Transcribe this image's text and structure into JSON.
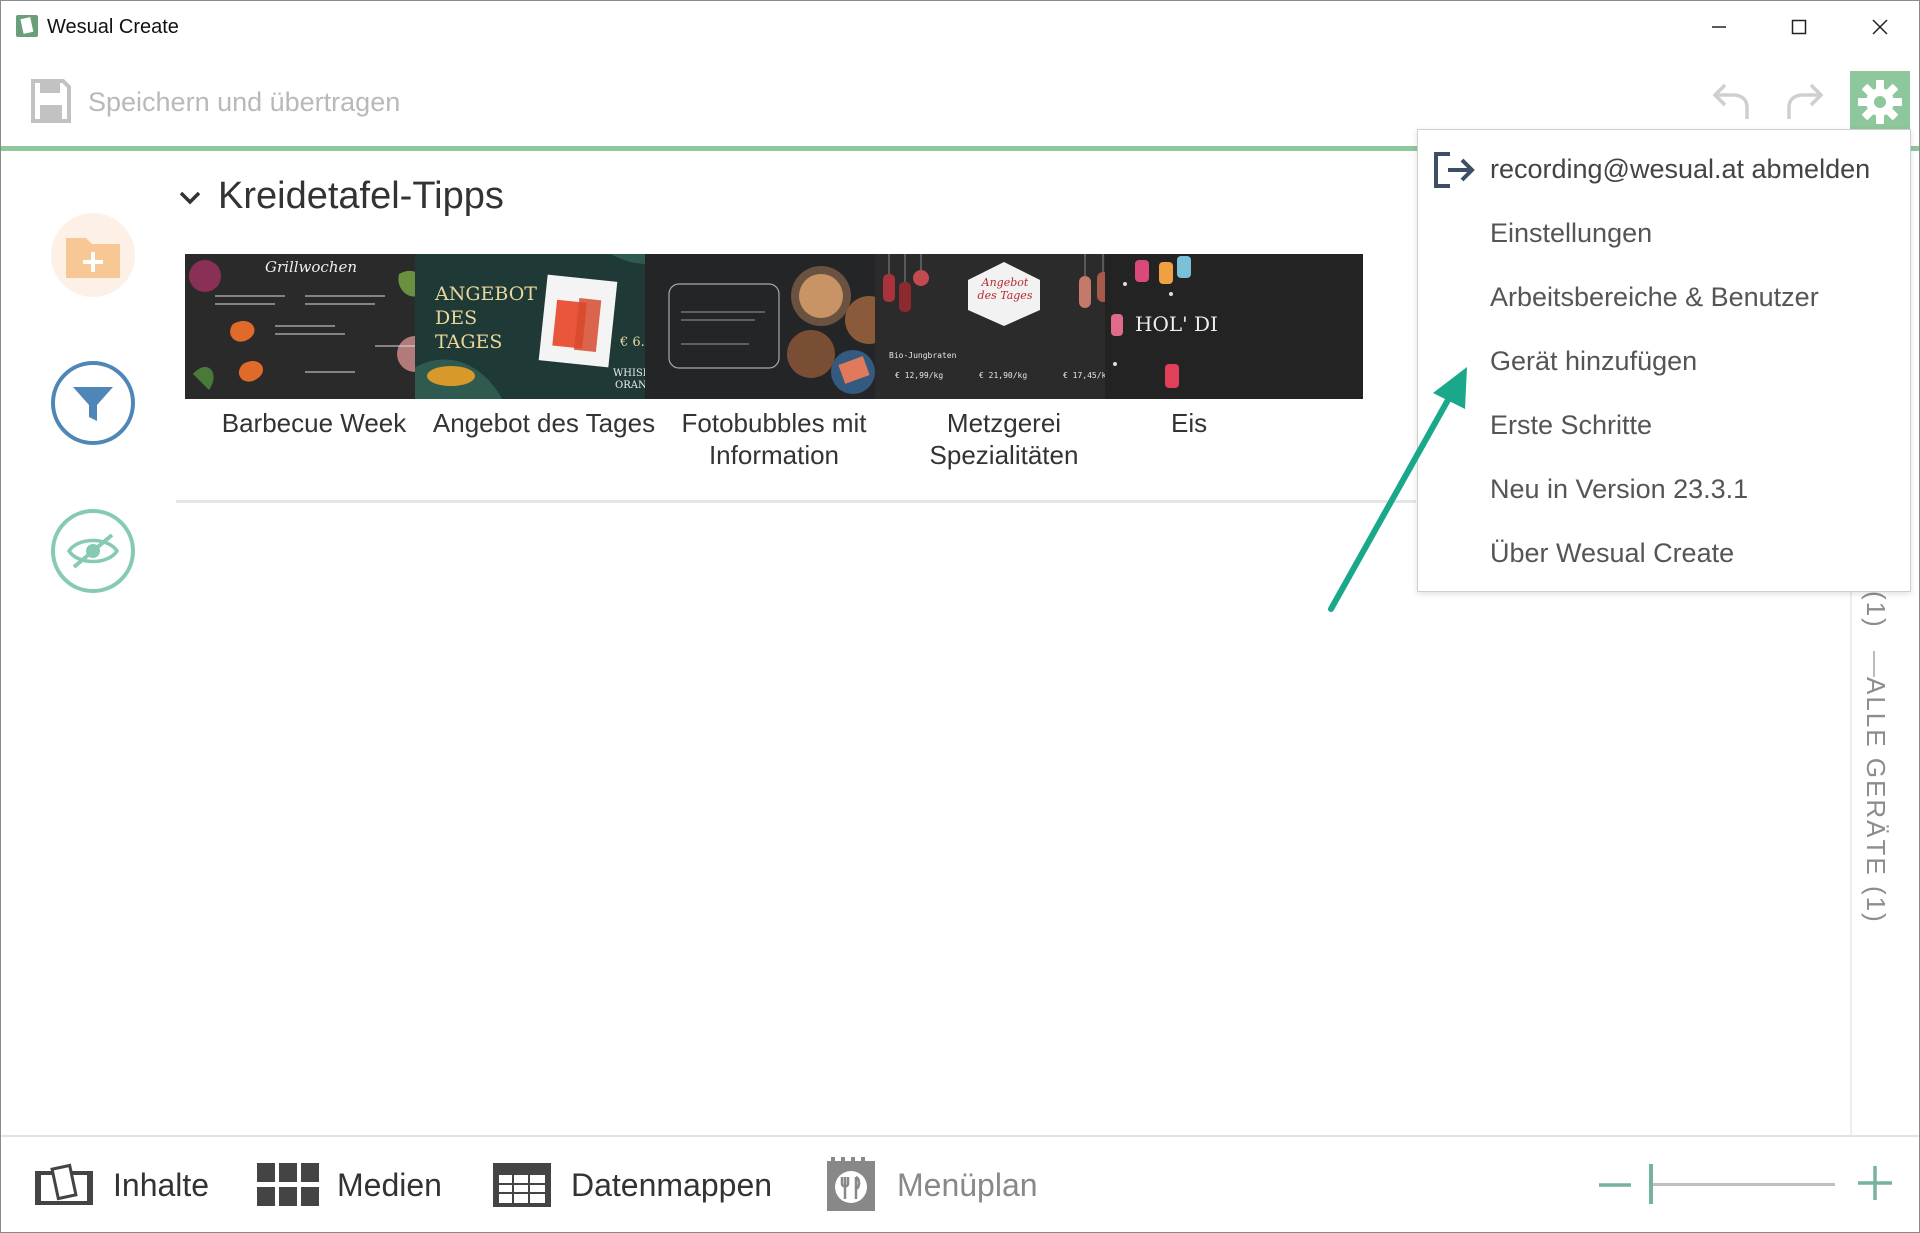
{
  "window": {
    "title": "Wesual Create"
  },
  "toolbar": {
    "save_label": "Speichern und übertragen"
  },
  "section": {
    "title": "Kreidetafel-Tipps",
    "items": [
      {
        "caption": "Barbecue Week",
        "art_text": "Grillwochen"
      },
      {
        "caption": "Angebot des Tages",
        "art_text": "ANGEBOT DES TAGES"
      },
      {
        "caption": "Fotobubbles mit Information",
        "art_text": ""
      },
      {
        "caption": "Metzgerei Spezialitäten",
        "art_text": "Angebot des Tages"
      },
      {
        "caption": "Eis",
        "art_text": "HOL' DI"
      }
    ]
  },
  "right_tabs": {
    "partial": "(1)",
    "all_devices": "ALLE GERÄTE (1)"
  },
  "menu": {
    "items": [
      "recording@wesual.at abmelden",
      "Einstellungen",
      "Arbeitsbereiche & Benutzer",
      "Gerät hinzufügen",
      "Erste Schritte",
      "Neu in Version 23.3.1",
      "Über Wesual Create"
    ]
  },
  "bottom_nav": {
    "items": [
      "Inhalte",
      "Medien",
      "Datenmappen",
      "Menüplan"
    ]
  },
  "colors": {
    "accent_green": "#8fc79c",
    "filter_blue": "#4f86b8",
    "eye_teal": "#86cbb1",
    "arrow_teal": "#1aa88a"
  },
  "icons": [
    "app-logo-icon",
    "minimize-icon",
    "maximize-icon",
    "close-icon",
    "save-icon",
    "undo-icon",
    "redo-icon",
    "gear-icon",
    "add-folder-icon",
    "filter-icon",
    "eye-hidden-icon",
    "chevron-down-icon",
    "logout-icon",
    "inhalte-icon",
    "medien-grid-icon",
    "datenmappen-table-icon",
    "menueplan-icon",
    "zoom-minus-icon",
    "zoom-plus-icon"
  ]
}
